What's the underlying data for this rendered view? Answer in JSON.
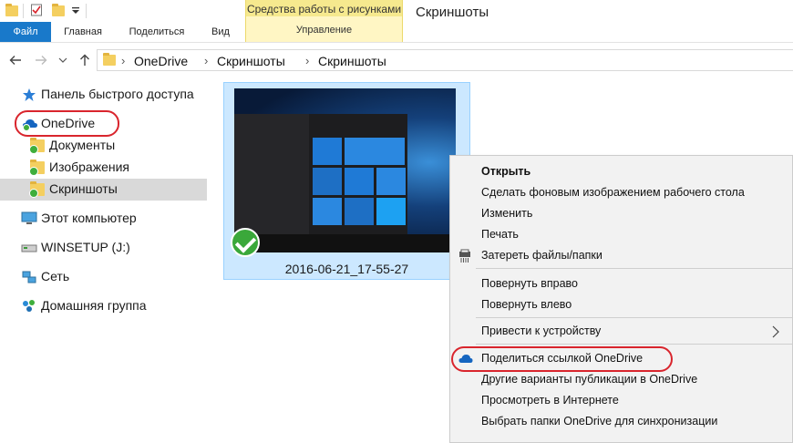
{
  "window": {
    "title": "Скриншоты"
  },
  "context_tab_group": {
    "title": "Средства работы с рисунками",
    "tab": "Управление"
  },
  "ribbon_tabs": [
    "Файл",
    "Главная",
    "Поделиться",
    "Вид"
  ],
  "address": {
    "crumbs": [
      "OneDrive",
      "Скриншоты",
      "Скриншоты"
    ]
  },
  "nav": {
    "quick_access": "Панель быстрого доступа",
    "onedrive": "OneDrive",
    "documents": "Документы",
    "images": "Изображения",
    "screenshots": "Скриншоты",
    "this_pc": "Этот компьютер",
    "winsetup": "WINSETUP (J:)",
    "network": "Сеть",
    "homegroup": "Домашняя группа"
  },
  "file": {
    "name": "2016-06-21_17-55-27"
  },
  "context_menu": {
    "open": "Открыть",
    "set_wallpaper": "Сделать фоновым изображением рабочего стола",
    "edit": "Изменить",
    "print": "Печать",
    "shred": "Затереть файлы/папки",
    "rotate_right": "Повернуть вправо",
    "rotate_left": "Повернуть влево",
    "cast": "Привести к устройству",
    "share_link": "Поделиться ссылкой OneDrive",
    "more_share": "Другие варианты публикации в OneDrive",
    "view_online": "Просмотреть в Интернете",
    "choose_folders": "Выбрать папки OneDrive для синхронизации"
  },
  "colors": {
    "accent": "#1979ca",
    "highlight_oval": "#d9252d",
    "selection": "#cce8ff"
  },
  "icons": [
    "folder-icon",
    "checklist-icon",
    "dropdown-icon",
    "back-arrow-icon",
    "forward-arrow-icon",
    "expand-icon",
    "up-arrow-icon",
    "star-icon",
    "onedrive-cloud-icon",
    "computer-icon",
    "drive-icon",
    "network-icon",
    "homegroup-icon",
    "sync-check-icon",
    "shredder-icon",
    "chevron-right-icon"
  ]
}
